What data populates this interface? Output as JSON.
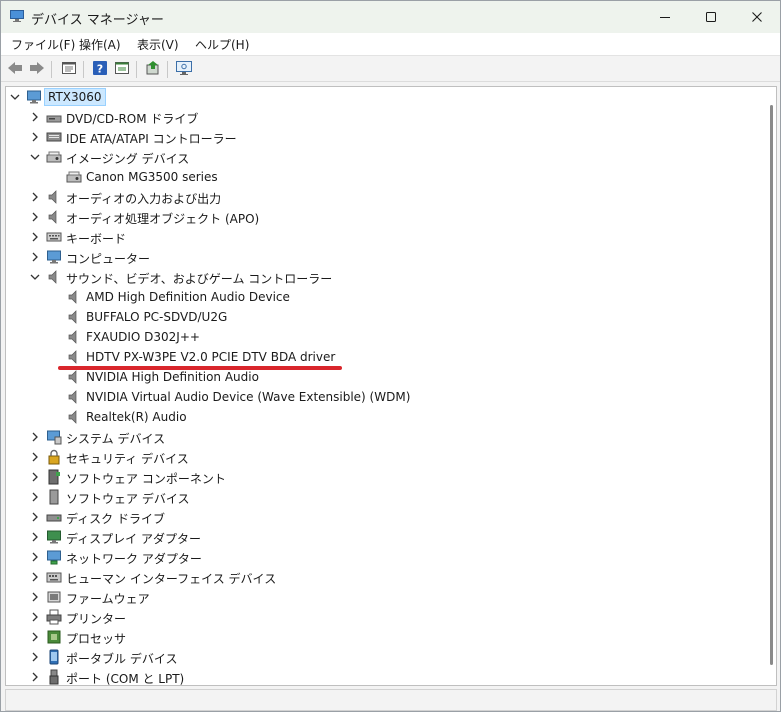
{
  "window": {
    "title": "デバイス マネージャー",
    "icon": "device-manager-icon",
    "controls": [
      "minimize-icon",
      "maximize-icon",
      "close-icon"
    ]
  },
  "menu": {
    "file": "ファイル(F)",
    "action": "操作(A)",
    "view": "表示(V)",
    "help": "ヘルプ(H)"
  },
  "toolbar": {
    "buttons": [
      "back-arrow-icon",
      "forward-arrow-icon",
      "properties-icon",
      "help-icon",
      "view-icon",
      "update-driver-icon",
      "monitor-scan-icon"
    ]
  },
  "tree": {
    "root": "RTX3060",
    "items": [
      "DVD/CD-ROM ドライブ",
      "IDE ATA/ATAPI コントローラー",
      "イメージング デバイス",
      "Canon MG3500 series",
      "オーディオの入力および出力",
      "オーディオ処理オブジェクト (APO)",
      "キーボード",
      "コンピューター",
      "サウンド、ビデオ、およびゲーム コントローラー",
      "AMD High Definition Audio Device",
      "BUFFALO PC-SDVD/U2G",
      "FXAUDIO D302J++",
      "HDTV PX-W3PE V2.0 PCIE DTV BDA driver",
      "NVIDIA High Definition Audio",
      "NVIDIA Virtual Audio Device (Wave Extensible) (WDM)",
      "Realtek(R) Audio",
      "システム デバイス",
      "セキュリティ デバイス",
      "ソフトウェア コンポーネント",
      "ソフトウェア デバイス",
      "ディスク ドライブ",
      "ディスプレイ アダプター",
      "ネットワーク アダプター",
      "ヒューマン インターフェイス デバイス",
      "ファームウェア",
      "プリンター",
      "プロセッサ",
      "ポータブル デバイス",
      "ポート (COM と LPT)"
    ]
  },
  "colors": {
    "selection": "#cce8ff",
    "highlight_underline": "#d9262c",
    "title_bar": "#eef3ed"
  }
}
